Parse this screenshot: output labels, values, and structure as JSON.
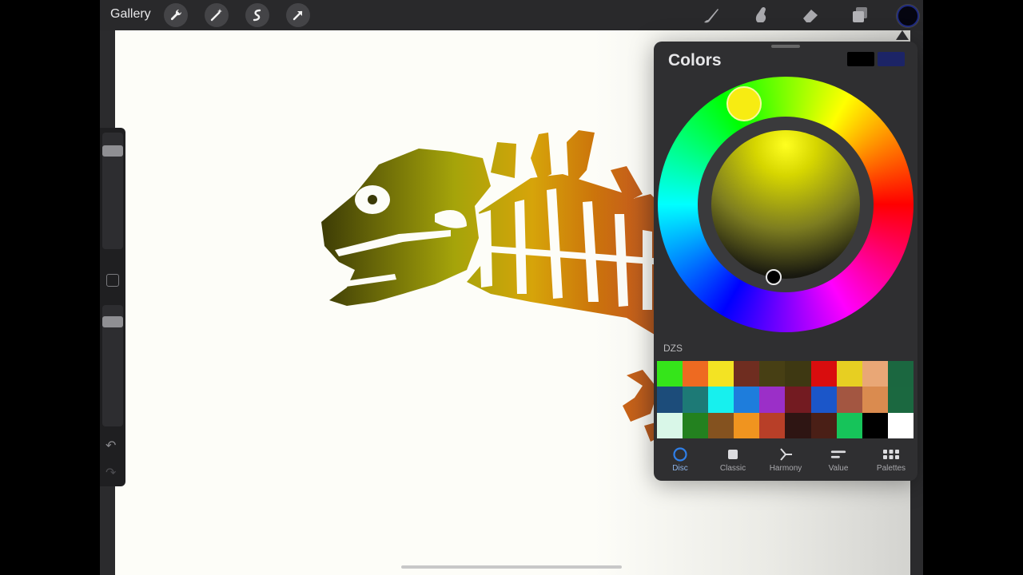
{
  "topbar": {
    "gallery_label": "Gallery",
    "left_tools": [
      "wrench-icon",
      "magic-wand-icon",
      "selection-icon",
      "transform-arrow-icon"
    ],
    "right_tools": [
      "brush-icon",
      "smudge-icon",
      "eraser-icon",
      "layers-icon"
    ],
    "current_color": "#050510"
  },
  "sidebar": {
    "brush_size_level": 0.12,
    "opacity_level": 0.1,
    "undo_icon": "undo-icon",
    "redo_icon": "redo-icon"
  },
  "colors_panel": {
    "title": "Colors",
    "primary_color": "#000000",
    "secondary_color": "#1c2466",
    "palette_name": "DZS",
    "palette": [
      "#35e51a",
      "#ee6a21",
      "#f3e323",
      "#6f2d20",
      "#473f14",
      "#3e3812",
      "#d90d0e",
      "#e7cf22",
      "#e9a776",
      "#1b6740",
      "#1c4c7a",
      "#1d7a76",
      "#17f0ee",
      "#1e7ddc",
      "#9b2fc8",
      "#731b21",
      "#1b56c9",
      "#a35641",
      "#da8b4f",
      "#1b6840",
      "#d9f7e8",
      "#23811f",
      "#84521f",
      "#f0941f",
      "#b83f28",
      "#2e1513",
      "#4a1f16",
      "#16c45a",
      "#000000",
      "#ffffff"
    ],
    "tabs": [
      {
        "label": "Disc",
        "icon": "disc-icon",
        "active": true
      },
      {
        "label": "Classic",
        "icon": "classic-square-icon",
        "active": false
      },
      {
        "label": "Harmony",
        "icon": "harmony-icon",
        "active": false
      },
      {
        "label": "Value",
        "icon": "value-sliders-icon",
        "active": false
      },
      {
        "label": "Palettes",
        "icon": "palettes-grid-icon",
        "active": false
      }
    ]
  }
}
